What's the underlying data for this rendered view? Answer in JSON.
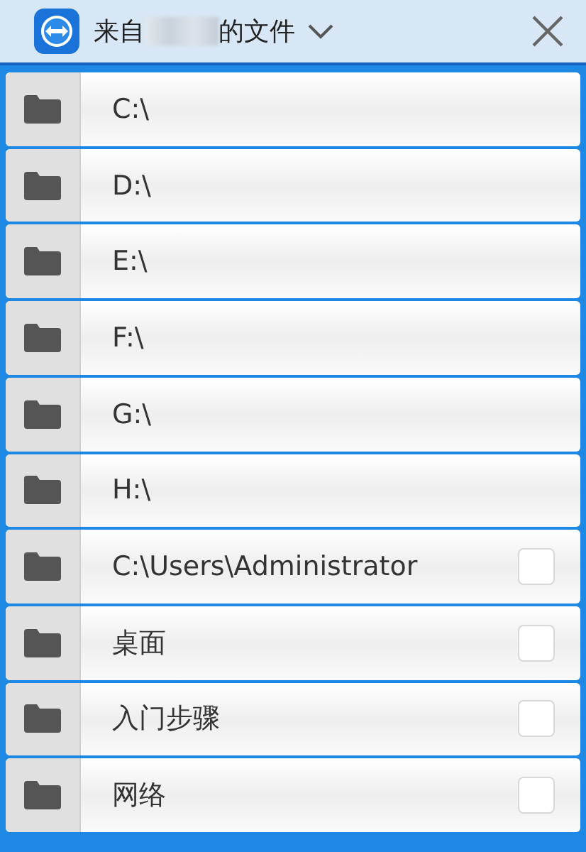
{
  "header": {
    "title_before": "来自",
    "title_after": "的文件"
  },
  "items": [
    {
      "name": "C:\\",
      "kind": "drive"
    },
    {
      "name": "D:\\",
      "kind": "drive"
    },
    {
      "name": "E:\\",
      "kind": "drive"
    },
    {
      "name": "F:\\",
      "kind": "drive"
    },
    {
      "name": "G:\\",
      "kind": "drive"
    },
    {
      "name": "H:\\",
      "kind": "drive"
    },
    {
      "name": "C:\\Users\\Administrator",
      "kind": "folder",
      "checked": false
    },
    {
      "name": "桌面",
      "kind": "folder",
      "checked": false
    },
    {
      "name": "入门步骤",
      "kind": "folder",
      "checked": false
    },
    {
      "name": "网络",
      "kind": "folder",
      "checked": false
    }
  ]
}
